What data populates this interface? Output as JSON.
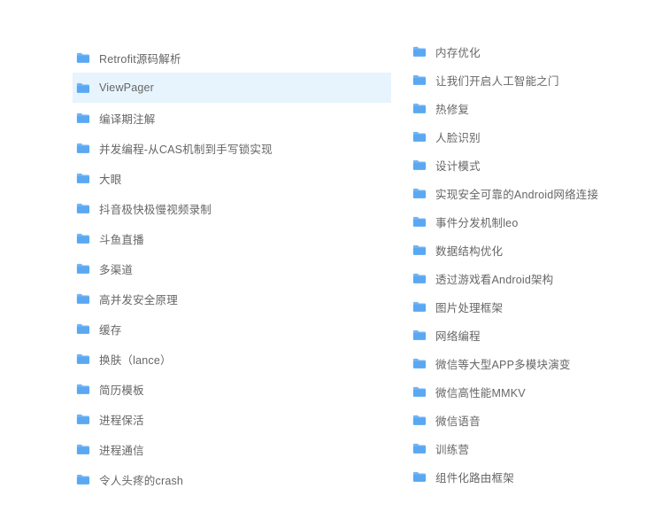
{
  "icon_color": "#5aa8f2",
  "left_items": [
    {
      "label": "Retrofit源码解析",
      "selected": false
    },
    {
      "label": "ViewPager",
      "selected": true
    },
    {
      "label": "编译期注解",
      "selected": false
    },
    {
      "label": "并发编程-从CAS机制到手写锁实现",
      "selected": false
    },
    {
      "label": "大眼",
      "selected": false
    },
    {
      "label": "抖音极快极慢视频录制",
      "selected": false
    },
    {
      "label": "斗鱼直播",
      "selected": false
    },
    {
      "label": "多渠道",
      "selected": false
    },
    {
      "label": "高并发安全原理",
      "selected": false
    },
    {
      "label": "缓存",
      "selected": false
    },
    {
      "label": "换肤（lance）",
      "selected": false
    },
    {
      "label": "简历模板",
      "selected": false
    },
    {
      "label": "进程保活",
      "selected": false
    },
    {
      "label": "进程通信",
      "selected": false
    },
    {
      "label": "令人头疼的crash",
      "selected": false
    }
  ],
  "right_items": [
    {
      "label": "内存优化"
    },
    {
      "label": "让我们开启人工智能之门"
    },
    {
      "label": "热修复"
    },
    {
      "label": "人脸识别"
    },
    {
      "label": "设计模式"
    },
    {
      "label": "实现安全可靠的Android网络连接"
    },
    {
      "label": "事件分发机制leo"
    },
    {
      "label": "数据结构优化"
    },
    {
      "label": "透过游戏看Android架构"
    },
    {
      "label": "图片处理框架"
    },
    {
      "label": "网络编程"
    },
    {
      "label": "微信等大型APP多模块演变"
    },
    {
      "label": "微信高性能MMKV"
    },
    {
      "label": "微信语音"
    },
    {
      "label": "训练营"
    },
    {
      "label": "组件化路由框架"
    }
  ]
}
